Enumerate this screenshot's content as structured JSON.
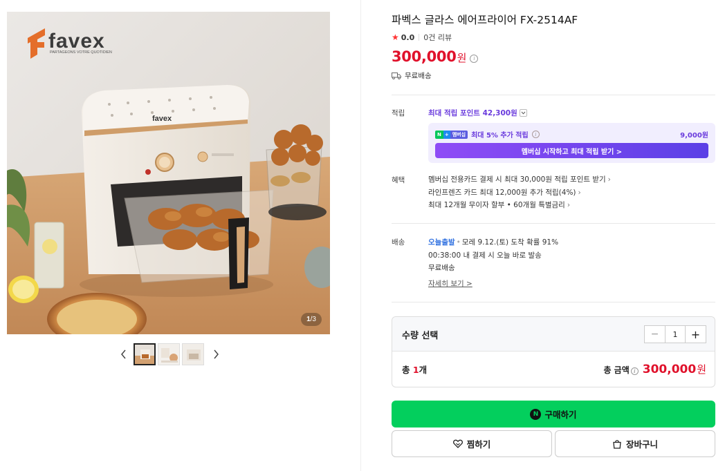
{
  "gallery": {
    "counter_current": "1",
    "counter_total": "/3",
    "brand_logo": "favex",
    "brand_tagline": "PARTAGEONS VOTRE QUOTIDIEN",
    "product_logo": "favex"
  },
  "product": {
    "title": "파벡스 글라스 에어프라이어 FX-2514AF",
    "rating": "0.0",
    "reviews": "0건 리뷰",
    "price": "300,000",
    "currency": "원",
    "shipping": "무료배송"
  },
  "points": {
    "label": "적립",
    "max_points": "최대 적립 포인트 42,300원",
    "membership_badge_n": "N",
    "membership_badge_plus": "+",
    "membership_badge_m": "멤버십",
    "membership_text": "최대 5% 추가 적립",
    "membership_amount": "9,000원",
    "membership_button": "멤버십 시작하고 최대 적립 받기 >"
  },
  "benefits": {
    "label": "혜택",
    "lines": [
      "멤버십 전용카드 결제 시 최대 30,000원 적립 포인트 받기",
      "라인프렌즈 카드 최대 12,000원 추가 적립(4%)",
      "최대 12개월 무이자 할부 • 60개월 특별금리"
    ]
  },
  "delivery": {
    "label": "배송",
    "today": "오늘출발",
    "arrival": "모레 9.12.(토) 도착 확률 91%",
    "cutoff": "00:38:00  내 결제 시 오늘 바로 발송",
    "free": "무료배송",
    "detail_link": "자세히 보기 >"
  },
  "quantity": {
    "title": "수량 선택",
    "value": "1",
    "minus": "−",
    "plus": "+",
    "total_prefix": "총 ",
    "total_count": "1",
    "total_suffix": "개",
    "total_label": "총 금액",
    "total_price": "300,000",
    "total_currency": "원"
  },
  "actions": {
    "buy_icon": "N",
    "buy": "구매하기",
    "wish": "찜하기",
    "cart": "장바구니"
  },
  "colors": {
    "price_red": "#e0112b",
    "naver_green": "#03cf5d",
    "membership_purple": "#6a3bdd"
  }
}
